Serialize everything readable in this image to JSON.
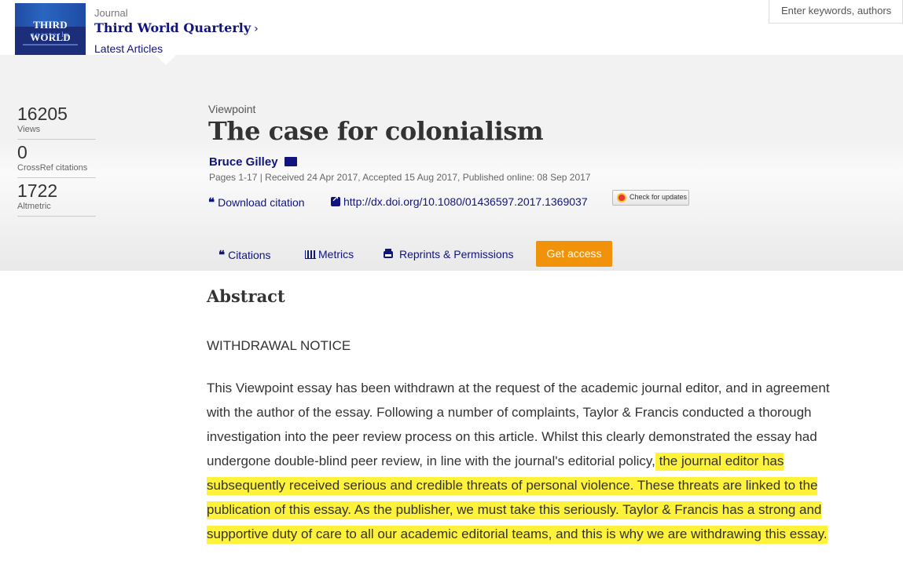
{
  "journal": {
    "label": "Journal",
    "title": "Third World Quarterly",
    "latest": "Latest Articles",
    "cover": {
      "line1": "THIRD WORLD",
      "line2": "quarterly"
    }
  },
  "search": {
    "placeholder": "Enter keywords, authors"
  },
  "metrics": [
    {
      "value": "16205",
      "label": "Views"
    },
    {
      "value": "0",
      "label": "CrossRef citations"
    },
    {
      "value": "1722",
      "label": "Altmetric"
    }
  ],
  "article": {
    "type": "Viewpoint",
    "title": "The case for colonialism",
    "author": "Bruce Gilley",
    "meta": "Pages 1-17 | Received 24 Apr 2017, Accepted 15 Aug 2017, Published online: 08 Sep 2017",
    "download_citation": "Download citation",
    "doi": "http://dx.doi.org/10.1080/01436597.2017.1369037",
    "check_updates": "Check for updates"
  },
  "tabs": {
    "citations": "Citations",
    "metrics": "Metrics",
    "reprints": "Reprints & Permissions",
    "access": "Get access"
  },
  "abstract": {
    "heading": "Abstract",
    "notice": "WITHDRAWAL NOTICE",
    "lines": [
      {
        "plain": "This Viewpoint essay has been withdrawn at the request of the academic journal editor, and in agreement",
        "hl": ""
      },
      {
        "plain": "with the author of the essay. Following a number of complaints, Taylor & Francis conducted a thorough",
        "hl": ""
      },
      {
        "plain": "investigation into the peer review process on this article. Whilst this clearly demonstrated the essay had",
        "hl": ""
      },
      {
        "plain": "undergone double-blind peer review, in line with the journal's editorial policy,",
        "hl": " the journal editor has"
      },
      {
        "plain": "",
        "hl": "subsequently received serious and credible threats of personal violence. These threats are linked to the"
      },
      {
        "plain": "",
        "hl": "publication of this essay. As the publisher, we must take this seriously. Taylor & Francis has a strong and"
      },
      {
        "plain": "",
        "hl": "supportive duty of care to all our academic editorial teams, and this is why we are withdrawing this essay."
      }
    ]
  },
  "colors": {
    "link": "#10147e",
    "accent": "#f0920a",
    "highlight": "#fff23a"
  },
  "icons": [
    "quote-icon",
    "external-link-icon",
    "envelope-icon",
    "bar-chart-icon",
    "printer-icon",
    "chevron-right-icon"
  ]
}
